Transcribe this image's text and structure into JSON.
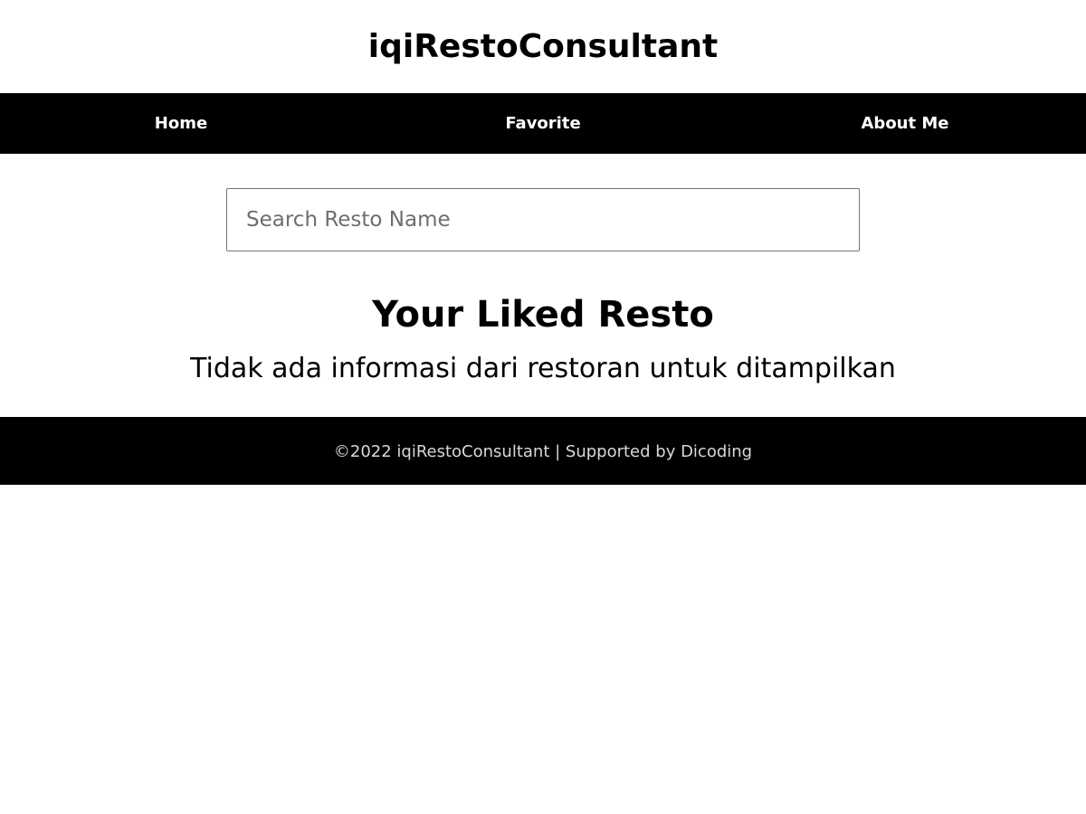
{
  "header": {
    "title": "iqiRestoConsultant"
  },
  "nav": {
    "items": [
      {
        "label": "Home"
      },
      {
        "label": "Favorite"
      },
      {
        "label": "About Me"
      }
    ]
  },
  "search": {
    "placeholder": "Search Resto Name",
    "value": ""
  },
  "main": {
    "section_title": "Your Liked Resto",
    "empty_message": "Tidak ada informasi dari restoran untuk ditampilkan"
  },
  "footer": {
    "text": "©2022 iqiRestoConsultant | Supported by Dicoding"
  },
  "colors": {
    "nav_background": "#000000",
    "footer_background": "#000000",
    "nav_text": "#ffffff",
    "page_background": "#ffffff"
  }
}
